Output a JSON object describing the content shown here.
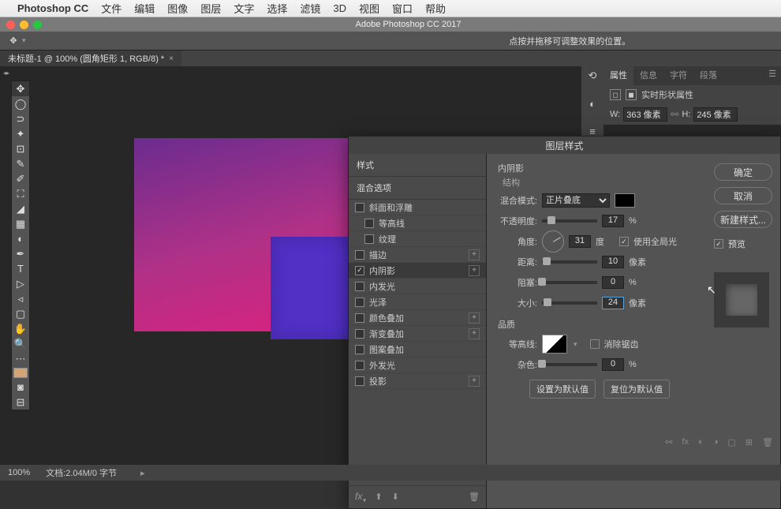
{
  "menubar": {
    "app_name": "Photoshop CC",
    "items": [
      "文件",
      "编辑",
      "图像",
      "图层",
      "文字",
      "选择",
      "滤镜",
      "3D",
      "视图",
      "窗口",
      "帮助"
    ]
  },
  "window": {
    "title": "Adobe Photoshop CC 2017",
    "traffic_colors": [
      "#ff5f57",
      "#ffbd2e",
      "#28c940"
    ]
  },
  "options_bar": {
    "hint": "点按并拖移可调整效果的位置。"
  },
  "doc_tab": {
    "title": "未标题-1 @ 100% (圆角矩形 1, RGB/8) *"
  },
  "properties_panel": {
    "tabs": [
      "属性",
      "信息",
      "字符",
      "段落"
    ],
    "subtitle": "实时形状属性",
    "w_label": "W:",
    "w_value": "363 像素",
    "h_label": "H:",
    "h_value": "245 像素"
  },
  "layer_style": {
    "dialog_title": "图层样式",
    "styles": {
      "header": "样式",
      "blending": "混合选项",
      "items": [
        {
          "label": "斜面和浮雕",
          "checked": false,
          "plus": false
        },
        {
          "label": "等高线",
          "checked": false,
          "plus": false
        },
        {
          "label": "纹理",
          "checked": false,
          "plus": false
        },
        {
          "label": "描边",
          "checked": false,
          "plus": true
        },
        {
          "label": "内阴影",
          "checked": true,
          "plus": true,
          "active": true
        },
        {
          "label": "内发光",
          "checked": false,
          "plus": false
        },
        {
          "label": "光泽",
          "checked": false,
          "plus": false
        },
        {
          "label": "颜色叠加",
          "checked": false,
          "plus": true
        },
        {
          "label": "渐变叠加",
          "checked": false,
          "plus": true
        },
        {
          "label": "图案叠加",
          "checked": false,
          "plus": false
        },
        {
          "label": "外发光",
          "checked": false,
          "plus": false
        },
        {
          "label": "投影",
          "checked": false,
          "plus": true
        }
      ]
    },
    "settings": {
      "title": "内阴影",
      "structure_label": "结构",
      "blend_mode_label": "混合模式:",
      "blend_mode_value": "正片叠底",
      "opacity_label": "不透明度:",
      "opacity_value": "17",
      "opacity_unit": "%",
      "angle_label": "角度:",
      "angle_value": "31",
      "angle_unit": "度",
      "global_light_label": "使用全局光",
      "global_light_checked": true,
      "distance_label": "距离:",
      "distance_value": "10",
      "distance_unit": "像素",
      "choke_label": "阻塞:",
      "choke_value": "0",
      "choke_unit": "%",
      "size_label": "大小:",
      "size_value": "24",
      "size_unit": "像素",
      "quality_label": "品质",
      "contour_label": "等高线:",
      "antialias_label": "消除锯齿",
      "antialias_checked": false,
      "noise_label": "杂色:",
      "noise_value": "0",
      "noise_unit": "%",
      "set_default": "设置为默认值",
      "reset_default": "复位为默认值"
    },
    "buttons": {
      "ok": "确定",
      "cancel": "取消",
      "new_style": "新建样式...",
      "preview": "预览",
      "preview_checked": true
    }
  },
  "status_bar": {
    "zoom": "100%",
    "doc_info": "文档:2.04M/0 字节"
  }
}
